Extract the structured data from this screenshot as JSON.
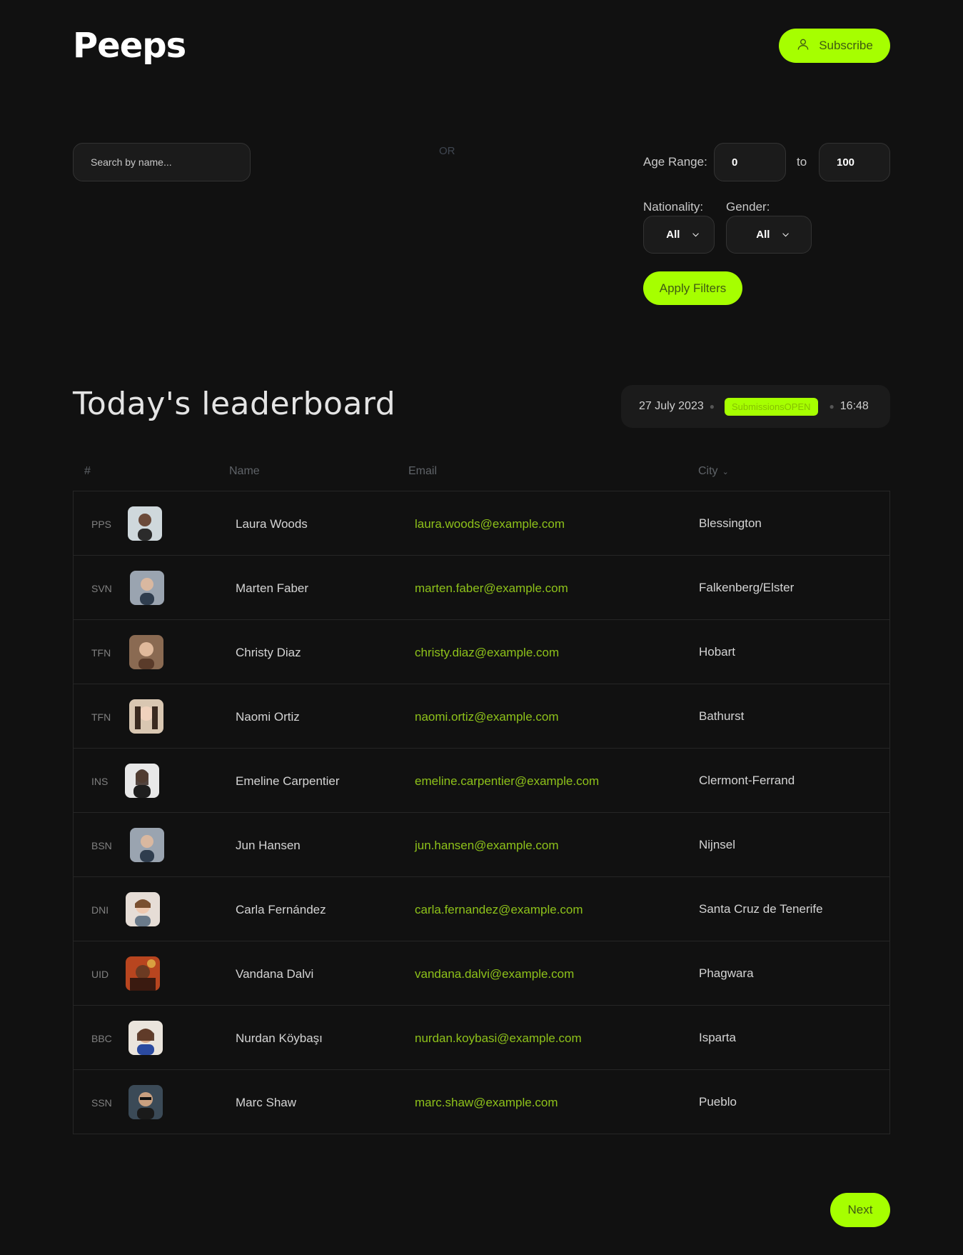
{
  "header": {
    "logo": "Peeps",
    "subscribe_label": "Subscribe",
    "subscribe_icon": "user-icon"
  },
  "filters": {
    "search_placeholder": "Search by name...",
    "or_label": "OR",
    "age_label": "Age Range:",
    "age_min": "0",
    "age_to": "to",
    "age_max": "100",
    "nationality_label": "Nationality:",
    "nationality_value": "All",
    "gender_label": "Gender:",
    "gender_value": "All",
    "apply_label": "Apply Filters"
  },
  "leaderboard": {
    "title": "Today's leaderboard",
    "date": "27 July 2023",
    "badge": "SubmissionsOPEN",
    "time": "16:48"
  },
  "table": {
    "headers": {
      "num": "#",
      "name": "Name",
      "email": "Email",
      "city": "City"
    },
    "rows": [
      {
        "code": "PPS",
        "name": "Laura Woods",
        "email": "laura.woods@example.com",
        "city": "Blessington",
        "avatar_color": "#cfd8dc"
      },
      {
        "code": "SVN",
        "name": "Marten Faber",
        "email": "marten.faber@example.com",
        "city": "Falkenberg/Elster",
        "avatar_color": "#9aa4b0"
      },
      {
        "code": "TFN",
        "name": "Christy Diaz",
        "email": "christy.diaz@example.com",
        "city": "Hobart",
        "avatar_color": "#8a6a52"
      },
      {
        "code": "TFN",
        "name": "Naomi Ortiz",
        "email": "naomi.ortiz@example.com",
        "city": "Bathurst",
        "avatar_color": "#d9c7b2"
      },
      {
        "code": "INS",
        "name": "Emeline Carpentier",
        "email": "emeline.carpentier@example.com",
        "city": "Clermont-Ferrand",
        "avatar_color": "#e8e8e8"
      },
      {
        "code": "BSN",
        "name": "Jun Hansen",
        "email": "jun.hansen@example.com",
        "city": "Nijnsel",
        "avatar_color": "#9aa4b0"
      },
      {
        "code": "DNI",
        "name": "Carla Fernández",
        "email": "carla.fernandez@example.com",
        "city": "Santa Cruz de Tenerife",
        "avatar_color": "#e6ddd6"
      },
      {
        "code": "UID",
        "name": "Vandana Dalvi",
        "email": "vandana.dalvi@example.com",
        "city": "Phagwara",
        "avatar_color": "#b8451f"
      },
      {
        "code": "BBC",
        "name": "Nurdan Köybaşı",
        "email": "nurdan.koybasi@example.com",
        "city": "Isparta",
        "avatar_color": "#eae4dc"
      },
      {
        "code": "SSN",
        "name": "Marc Shaw",
        "email": "marc.shaw@example.com",
        "city": "Pueblo",
        "avatar_color": "#3b4a57"
      }
    ]
  },
  "pagination": {
    "next_label": "Next"
  },
  "colors": {
    "accent": "#a6ff00",
    "email": "#8ec21a",
    "background": "#111111"
  }
}
